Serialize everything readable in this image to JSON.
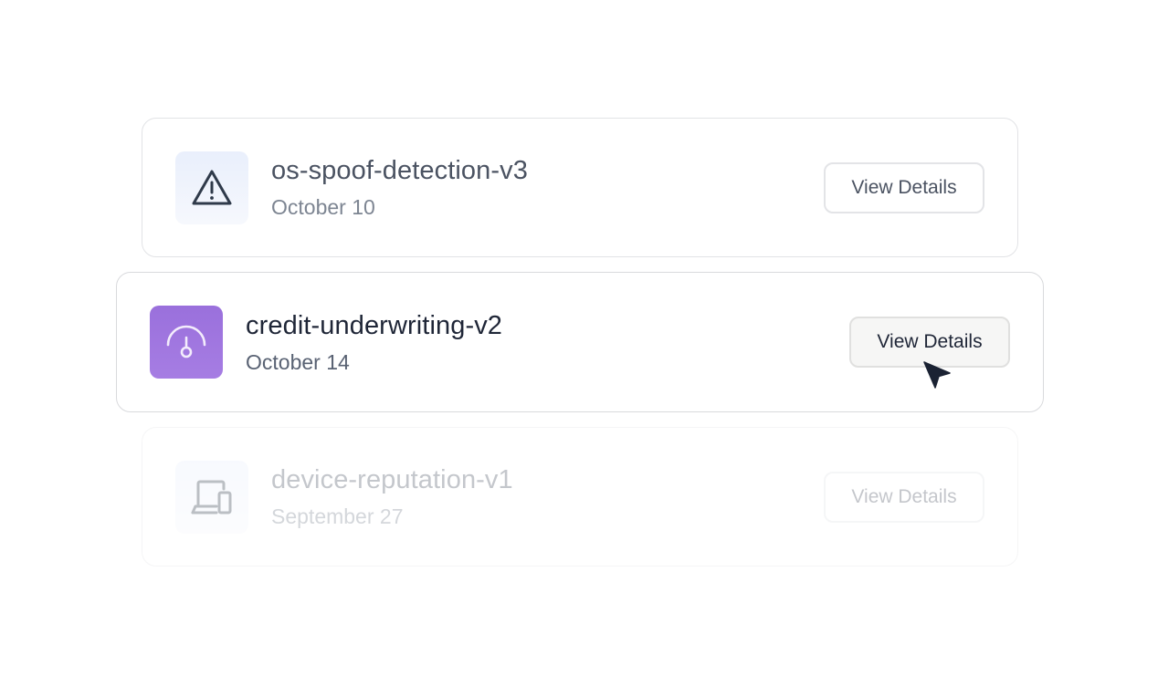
{
  "list": {
    "items": [
      {
        "name": "os-spoof-detection-v3",
        "date": "October 10",
        "action_label": "View Details",
        "icon": "warning-triangle-icon",
        "state": "normal"
      },
      {
        "name": "credit-underwriting-v2",
        "date": "October 14",
        "action_label": "View Details",
        "icon": "gauge-icon",
        "state": "hovered",
        "accent_color": "#9f77df"
      },
      {
        "name": "device-reputation-v1",
        "date": "September 27",
        "action_label": "View Details",
        "icon": "devices-icon",
        "state": "faded"
      }
    ]
  },
  "cursor": {
    "icon": "mouse-pointer-icon"
  }
}
